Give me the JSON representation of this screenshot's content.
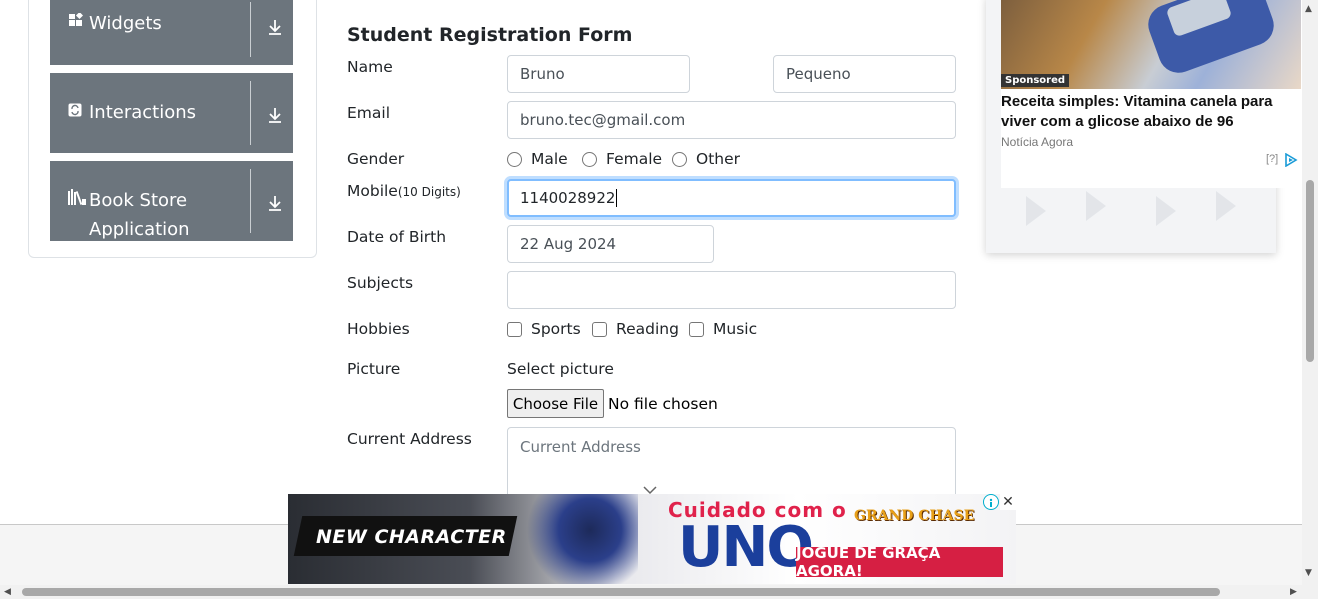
{
  "sidebar": {
    "groups": [
      {
        "label": "Widgets",
        "icon": "widgets-icon"
      },
      {
        "label": "Interactions",
        "icon": "interactions-icon"
      },
      {
        "label": "Book Store Application",
        "line1": "Book Store",
        "line2": "Application",
        "icon": "books-icon"
      }
    ],
    "bg_color": "#6c757d"
  },
  "form": {
    "title": "Student Registration Form",
    "name_label": "Name",
    "first_name": "Bruno",
    "last_name": "Pequeno",
    "email_label": "Email",
    "email": "bruno.tec@gmail.com",
    "gender_label": "Gender",
    "gender_options": [
      "Male",
      "Female",
      "Other"
    ],
    "mobile_label": "Mobile",
    "mobile_hint": "(10 Digits)",
    "mobile": "1140028922",
    "dob_label": "Date of Birth",
    "dob": "22 Aug 2024",
    "subjects_label": "Subjects",
    "subjects": "",
    "hobbies_label": "Hobbies",
    "hobbies": [
      "Sports",
      "Reading",
      "Music"
    ],
    "picture_label": "Picture",
    "select_picture": "Select picture",
    "choose_file": "Choose File",
    "no_file": "No file chosen",
    "address_label": "Current Address",
    "address_placeholder": "Current Address",
    "focus_color": "#80bdff"
  },
  "side_ad": {
    "sponsored": "Sponsored",
    "headline": "Receita simples: Vitamina canela para viver com a glicose abaixo de 96",
    "source": "Notícia Agora",
    "info": "[?]"
  },
  "banner_ad": {
    "new_character": "NEW CHARACTER",
    "tagline": "Cuidado com o",
    "headline": "UNO",
    "logo": "GRAND CHASE",
    "cta": "JOGUE DE GRAÇA AGORA!",
    "close": "✕",
    "cta_color": "#d61f43"
  }
}
